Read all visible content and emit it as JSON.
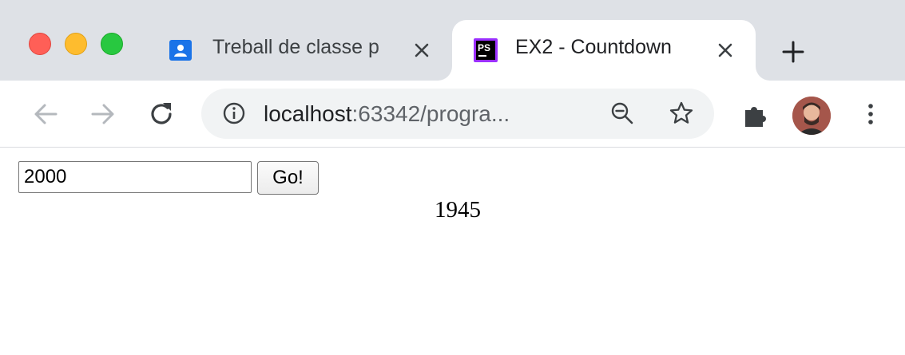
{
  "browser": {
    "tabs": [
      {
        "title": "Treball de classe p",
        "favicon": "google-classroom-icon",
        "active": false
      },
      {
        "title": "EX2 - Countdown",
        "favicon": "phpstorm-icon",
        "favicon_text": "PS",
        "active": true
      }
    ],
    "address_bar": {
      "host": "localhost",
      "rest": ":63342/progra..."
    }
  },
  "page": {
    "input_value": "2000",
    "button_label": "Go!",
    "countdown_value": "1945"
  },
  "colors": {
    "tabstrip_bg": "#dee1e6",
    "close_red": "#ff5f57",
    "minimize_yellow": "#febc2e",
    "zoom_green": "#28c840",
    "classroom_blue": "#1a73e8",
    "phpstorm_purple": "#9b30ff"
  }
}
